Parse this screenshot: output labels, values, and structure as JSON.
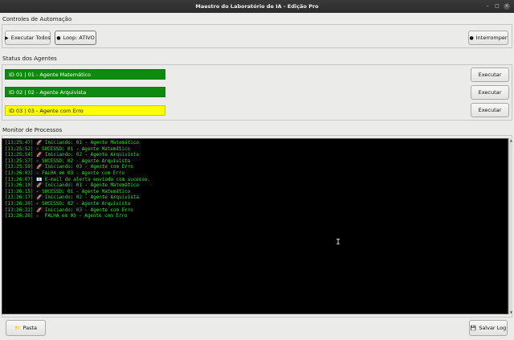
{
  "window": {
    "title": "Maestro do Laboratório de IA - Edição Pro",
    "controls": {
      "minimize": "–",
      "maximize": "□",
      "close": "×"
    }
  },
  "automation": {
    "section_label": "Controles de Automação",
    "run_all_label": "Executar Todos",
    "run_all_icon": "▶",
    "loop_label": "Loop: ATIVO",
    "loop_icon": "●",
    "stop_label": "Interromper",
    "stop_icon": "●"
  },
  "agents": {
    "section_label": "Status dos Agentes",
    "items": [
      {
        "label": "ID 01 | 01 - Agente Matemático",
        "status": "ok",
        "color": "#0f8a0f",
        "run_label": "Executar"
      },
      {
        "label": "ID 02 | 02 - Agente Arquivista",
        "status": "ok",
        "color": "#0f8a0f",
        "run_label": "Executar"
      },
      {
        "label": "ID 03 | 03 - Agente com Erro",
        "status": "error",
        "color": "#ffff00",
        "run_label": "Executar"
      }
    ]
  },
  "monitor": {
    "section_label": "Monitor de Processos",
    "lines": [
      "[13:25:47] 🚀 Iniciando: 01 - Agente Matemático",
      "[13:25:52] ✓ SUCESSO: 01 - Agente Matemático",
      "[13:25:54] 🚀 Iniciando: 02 - Agente Arquivista",
      "[13:25:57] ✓ SUCESSO: 02 - Agente Arquivista",
      "[13:25:59] 🚀 Iniciando: 03 - Agente com Erro",
      "[13:26:03] ⚠ FALHA em 03 - Agente com Erro",
      "[13:26:07] 📧 E-mail de alerta enviado com sucesso.",
      "[13:26:10] 🚀 Iniciando: 01 - Agente Matemático",
      "[13:26:15] ✓ SUCESSO: 01 - Agente Matemático",
      "[13:26:17] 🚀 Iniciando: 02 - Agente Arquivista",
      "[13:26:20] ✓ SUCESSO: 02 - Agente Arquivista",
      "[13:26:22] 🚀 Iniciando: 03 - Agente com Erro",
      "[13:26:26] ⚠  FALHA em 03 - Agente com Erro"
    ],
    "text_color": "#2ee02e",
    "background": "#000000"
  },
  "footer": {
    "folder_label": "Pasta",
    "folder_icon": "📁",
    "save_label": "Salvar Log",
    "save_icon": "💾"
  }
}
